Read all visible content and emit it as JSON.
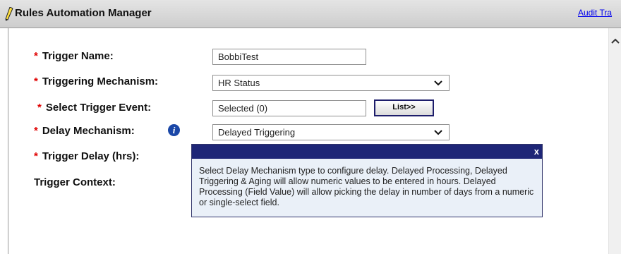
{
  "header": {
    "title": "Rules Automation Manager",
    "audit_link": "Audit Tra"
  },
  "form": {
    "required_marker": "*",
    "trigger_name": {
      "label": "Trigger Name:",
      "value": "BobbiTest"
    },
    "triggering_mechanism": {
      "label": "Triggering Mechanism:",
      "value": "HR Status"
    },
    "trigger_event": {
      "label": "Select Trigger Event:",
      "value": "Selected (0)",
      "button": "List>>"
    },
    "delay_mechanism": {
      "label": "Delay Mechanism:",
      "value": "Delayed Triggering",
      "info_glyph": "i"
    },
    "trigger_delay": {
      "label": "Trigger Delay (hrs):"
    },
    "trigger_context": {
      "label": "Trigger Context:"
    }
  },
  "tooltip": {
    "close": "x",
    "text": "Select Delay Mechanism type to configure delay. Delayed Processing, Delayed Triggering & Aging will allow numeric values to be entered in hours. Delayed Processing (Field Value) will allow picking the delay in number of days from a numeric or single-select field."
  },
  "colors": {
    "required": "#e00000",
    "tooltip_header": "#1e2677",
    "tooltip_bg": "#eaf0f8",
    "link": "#0000ee",
    "info_icon": "#1a47a7"
  },
  "icons": {
    "title": "pencil-icon",
    "info": "info-icon",
    "dropdown": "chevron-down-icon",
    "scroll": "scroll-up-icon"
  }
}
